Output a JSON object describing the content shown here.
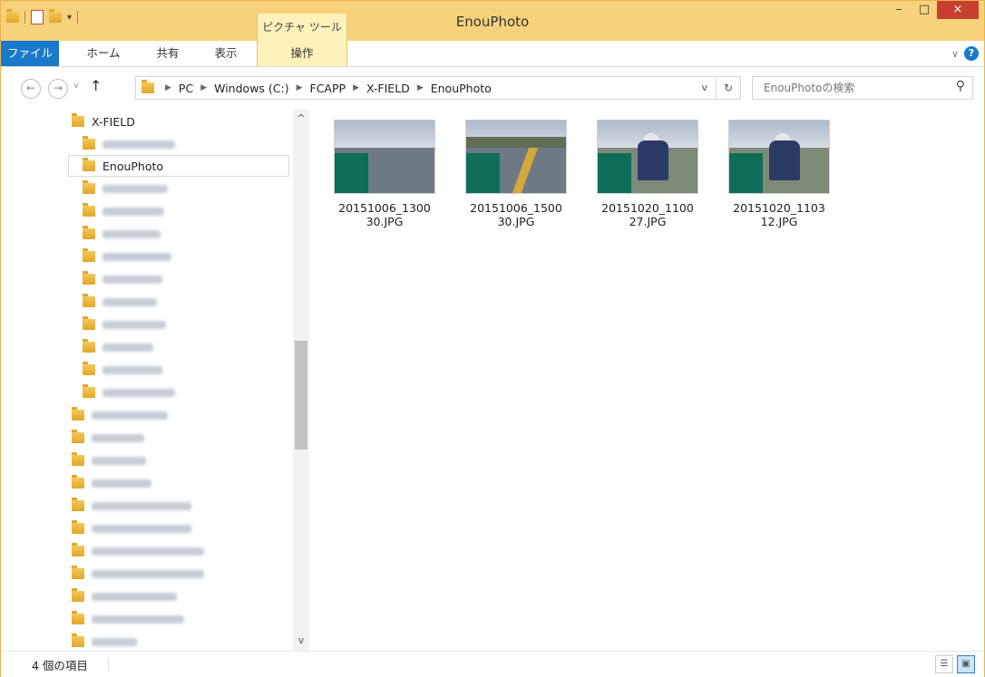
{
  "window": {
    "title": "EnouPhoto",
    "context_tab_group": "ピクチャ ツール",
    "controls": {
      "minimize": "–",
      "maximize": "□",
      "close": "×"
    }
  },
  "ribbon": {
    "tabs": [
      {
        "label": "ファイル"
      },
      {
        "label": "ホーム"
      },
      {
        "label": "共有"
      },
      {
        "label": "表示"
      },
      {
        "label": "操作"
      }
    ],
    "expand_icon": "chevron-down-icon",
    "help_label": "?"
  },
  "address": {
    "back": "←",
    "forward": "→",
    "recent": "v",
    "up": "↑",
    "breadcrumbs": [
      "PC",
      "Windows (C:)",
      "FCAPP",
      "X-FIELD",
      "EnouPhoto"
    ],
    "dropdown": "v",
    "refresh": "↻"
  },
  "search": {
    "placeholder": "EnouPhotoの検索",
    "icon": "search-icon"
  },
  "navpane": {
    "parent": "X-FIELD",
    "selected": "EnouPhoto",
    "up_arrow": "^",
    "down_arrow": "v"
  },
  "files": [
    {
      "line1": "20151006_1300",
      "line2": "30.JPG"
    },
    {
      "line1": "20151006_1500",
      "line2": "30.JPG"
    },
    {
      "line1": "20151020_1100",
      "line2": "27.JPG"
    },
    {
      "line1": "20151020_1103",
      "line2": "12.JPG"
    }
  ],
  "status": {
    "item_count": "4 個の項目",
    "view_details_icon": "details-view-icon",
    "view_large_icon": "large-icons-view-icon"
  },
  "colors": {
    "titlebar": "#f7d17b",
    "file_tab": "#1979ca",
    "context_tab": "#fdf2b9",
    "close_button": "#c7402f"
  }
}
